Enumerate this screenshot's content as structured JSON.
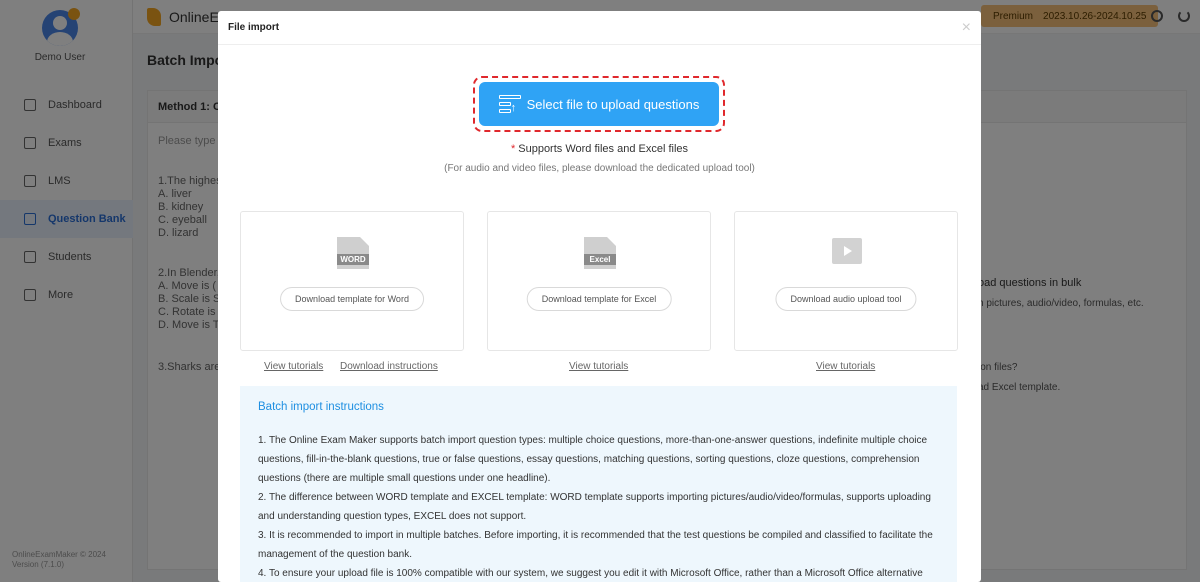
{
  "sidebar": {
    "user_name": "Demo User",
    "items": [
      {
        "label": "Dashboard",
        "icon": "home-icon"
      },
      {
        "label": "Exams",
        "icon": "pen-icon"
      },
      {
        "label": "LMS",
        "icon": "book-icon"
      },
      {
        "label": "Question Bank",
        "icon": "chart-icon",
        "active": true
      },
      {
        "label": "Students",
        "icon": "user-icon"
      },
      {
        "label": "More",
        "icon": "grid-icon"
      }
    ],
    "copyright_1": "OnlineExamMaker © 2024",
    "copyright_2": "Version (7.1.0)"
  },
  "topbar": {
    "brand": "OnlineEx",
    "plan": "Premium",
    "validity": "2023.10.26-2024.10.25"
  },
  "background": {
    "page_title": "Batch Impor",
    "method_title": "Method 1: Cc",
    "placeholder": "Please type c",
    "q1": "1.The highes\nA. liver\nB. kidney\nC. eyeball\nD. lizard",
    "q2": "2.In Blender,\nA. Move is (\nB. Scale is S\nC. Rotate is\nD. Move is T",
    "q3": "3.Sharks are",
    "right_title": "oad questions in bulk",
    "right_sub": "h pictures, audio/video, formulas, etc.",
    "right_q": "ion files?",
    "right_q2": "ad Excel template."
  },
  "modal": {
    "title": "File import",
    "close": "×",
    "upload_label": "Select file to upload questions",
    "support_star": "*",
    "support_text": "Supports Word files and Excel files",
    "support_note": "(For audio and video files, please download the dedicated upload tool)",
    "cards": [
      {
        "icon_tag": "WORD",
        "button": "Download template for Word"
      },
      {
        "icon_tag": "Excel",
        "button": "Download template for Excel"
      },
      {
        "icon_tag": "",
        "button": "Download audio upload tool"
      }
    ],
    "links": {
      "word_tutorials": "View tutorials",
      "word_instructions": "Download instructions",
      "excel_tutorials": "View tutorials",
      "audio_tutorials": "View tutorials"
    },
    "instructions": {
      "title": "Batch import instructions",
      "items": [
        "1. The Online Exam Maker supports batch import question types: multiple choice questions, more-than-one-answer questions, indefinite multiple choice questions, fill-in-the-blank questions, true or false questions, essay questions, matching questions, sorting questions, cloze questions, comprehension questions (there are multiple small questions under one headline).",
        "2. The difference between WORD template and EXCEL template: WORD template supports importing pictures/audio/video/formulas, supports uploading and understanding question types, EXCEL does not support.",
        "3. It is recommended to import in multiple batches. Before importing, it is recommended that the test questions be compiled and classified to facilitate the management of the question bank.",
        "4. To ensure your upload file is 100% compatible with our system, we suggest you edit it with Microsoft Office, rather than a Microsoft Office alternative"
      ]
    }
  }
}
